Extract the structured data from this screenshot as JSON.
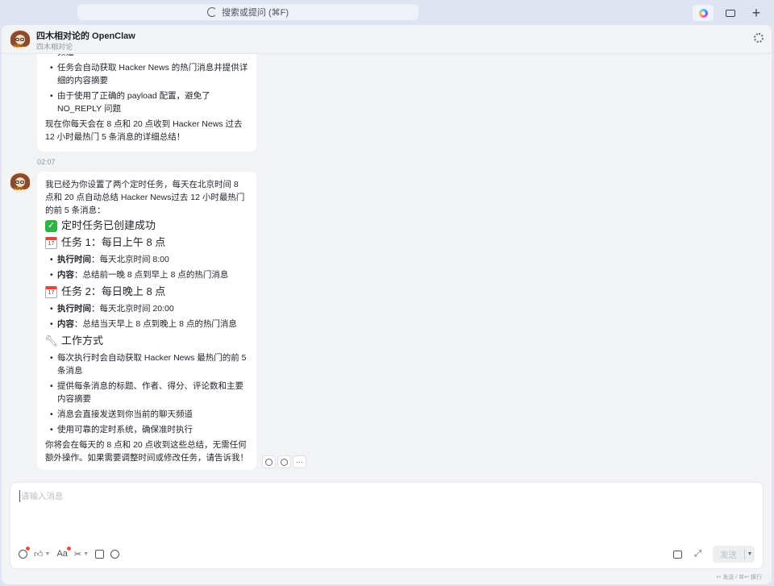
{
  "topbar": {
    "search_placeholder": "搜索或提问 (⌘F)",
    "plus_label": "+"
  },
  "header": {
    "title": "四木相对论的 OpenClaw",
    "subtitle": "四木相对论",
    "avatar_tag": "ABO"
  },
  "message1": {
    "frag_top": "频道",
    "bullets": [
      "任务会自动获取 Hacker News 的热门消息并提供详细的内容摘要",
      "由于使用了正确的 payload 配置，避免了 NO_REPLY 问题"
    ],
    "closing": "现在你每天会在 8 点和 20 点收到 Hacker News 过去 12 小时最热门 5 条消息的详细总结！"
  },
  "timestamp": "02:07",
  "message2": {
    "intro": "我已经为你设置了两个定时任务，每天在北京时间 8 点和 20 点自动总结 Hacker News过去 12 小时最热门的前 5 条消息：",
    "h_success": "定时任务已创建成功",
    "task1": {
      "title": "任务 1：每日上午 8 点",
      "k1": "执行时间",
      "v1": "：每天北京时间 8:00",
      "k2": "内容",
      "v2": "：总结前一晚 8 点到早上 8 点的热门消息"
    },
    "task2": {
      "title": "任务 2：每日晚上 8 点",
      "k1": "执行时间",
      "v1": "：每天北京时间 20:00",
      "k2": "内容",
      "v2": "：总结当天早上 8 点到晚上 8 点的热门消息"
    },
    "calendar_glyph": "17",
    "h_method": "工作方式",
    "method": [
      "每次执行时会自动获取 Hacker News 最热门的前 5 条消息",
      "提供每条消息的标题、作者、得分、评论数和主要内容摘要",
      "消息会直接发送到你当前的聊天频道",
      "使用可靠的定时系统，确保准时执行"
    ],
    "closing": "你将会在每天的 8 点和 20 点收到这些总结，无需任何额外操作。如果需要调整时间或修改任务，请告诉我！"
  },
  "composer": {
    "placeholder": "请输入消息",
    "send_label": "发送",
    "hint": "↩ 发送 / ⌘↩ 换行",
    "font_tool": "Aa"
  }
}
